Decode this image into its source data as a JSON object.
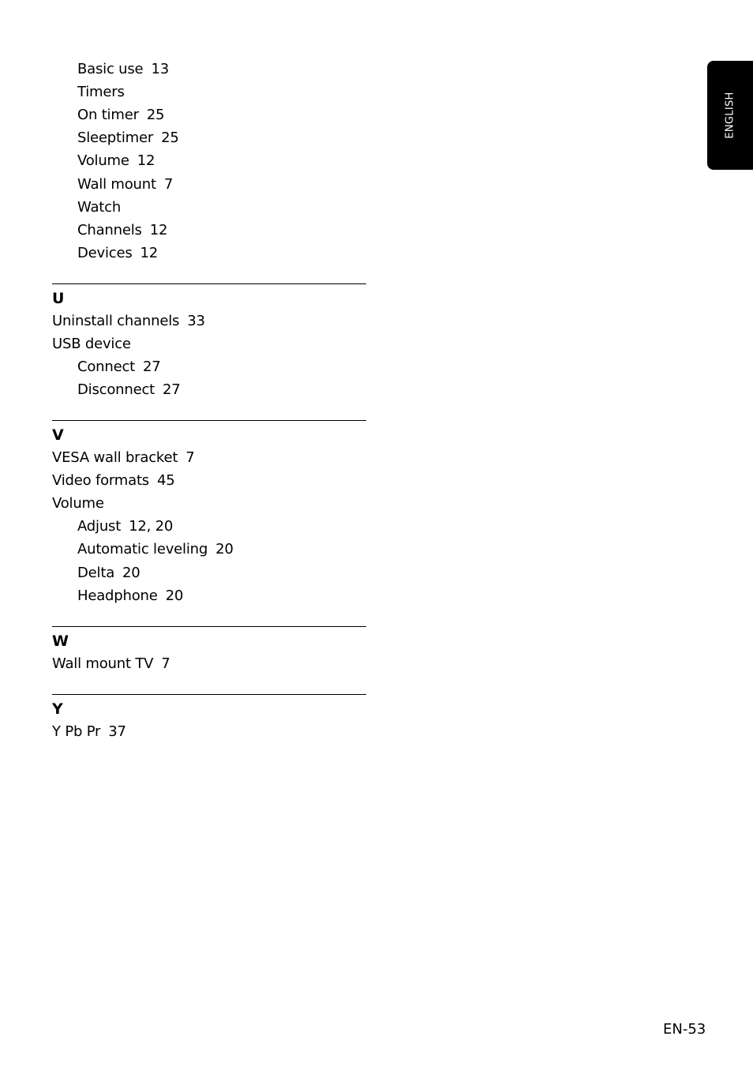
{
  "language_tab": {
    "label": "ENGLISH",
    "background": "#000000",
    "text_color": "#ffffff"
  },
  "continued_entries": [
    {
      "term": "Basic use",
      "pages": "13",
      "level": 1
    },
    {
      "term": "Timers",
      "pages": "",
      "level": 1
    },
    {
      "term": "On timer",
      "pages": "25",
      "level": 1
    },
    {
      "term": "Sleeptimer",
      "pages": "25",
      "level": 1
    },
    {
      "term": "Volume",
      "pages": "12",
      "level": 1
    },
    {
      "term": "Wall mount",
      "pages": "7",
      "level": 1
    },
    {
      "term": "Watch",
      "pages": "",
      "level": 1
    },
    {
      "term": "Channels",
      "pages": "12",
      "level": 1
    },
    {
      "term": "Devices",
      "pages": "12",
      "level": 1
    }
  ],
  "sections": [
    {
      "letter": "U",
      "entries": [
        {
          "term": "Uninstall channels",
          "pages": "33",
          "level": 0
        },
        {
          "term": "USB device",
          "pages": "",
          "level": 0
        },
        {
          "term": "Connect",
          "pages": "27",
          "level": 1
        },
        {
          "term": "Disconnect",
          "pages": "27",
          "level": 1
        }
      ]
    },
    {
      "letter": "V",
      "entries": [
        {
          "term": "VESA wall bracket",
          "pages": "7",
          "level": 0
        },
        {
          "term": "Video formats",
          "pages": "45",
          "level": 0
        },
        {
          "term": "Volume",
          "pages": "",
          "level": 0
        },
        {
          "term": "Adjust",
          "pages": "12, 20",
          "level": 1
        },
        {
          "term": "Automatic leveling",
          "pages": "20",
          "level": 1
        },
        {
          "term": "Delta",
          "pages": "20",
          "level": 1
        },
        {
          "term": "Headphone",
          "pages": "20",
          "level": 1
        }
      ]
    },
    {
      "letter": "W",
      "entries": [
        {
          "term": "Wall mount TV",
          "pages": "7",
          "level": 0
        }
      ]
    },
    {
      "letter": "Y",
      "entries": [
        {
          "term": "Y Pb Pr",
          "pages": "37",
          "level": 0
        }
      ]
    }
  ],
  "footer": {
    "page_number": "EN-53"
  }
}
